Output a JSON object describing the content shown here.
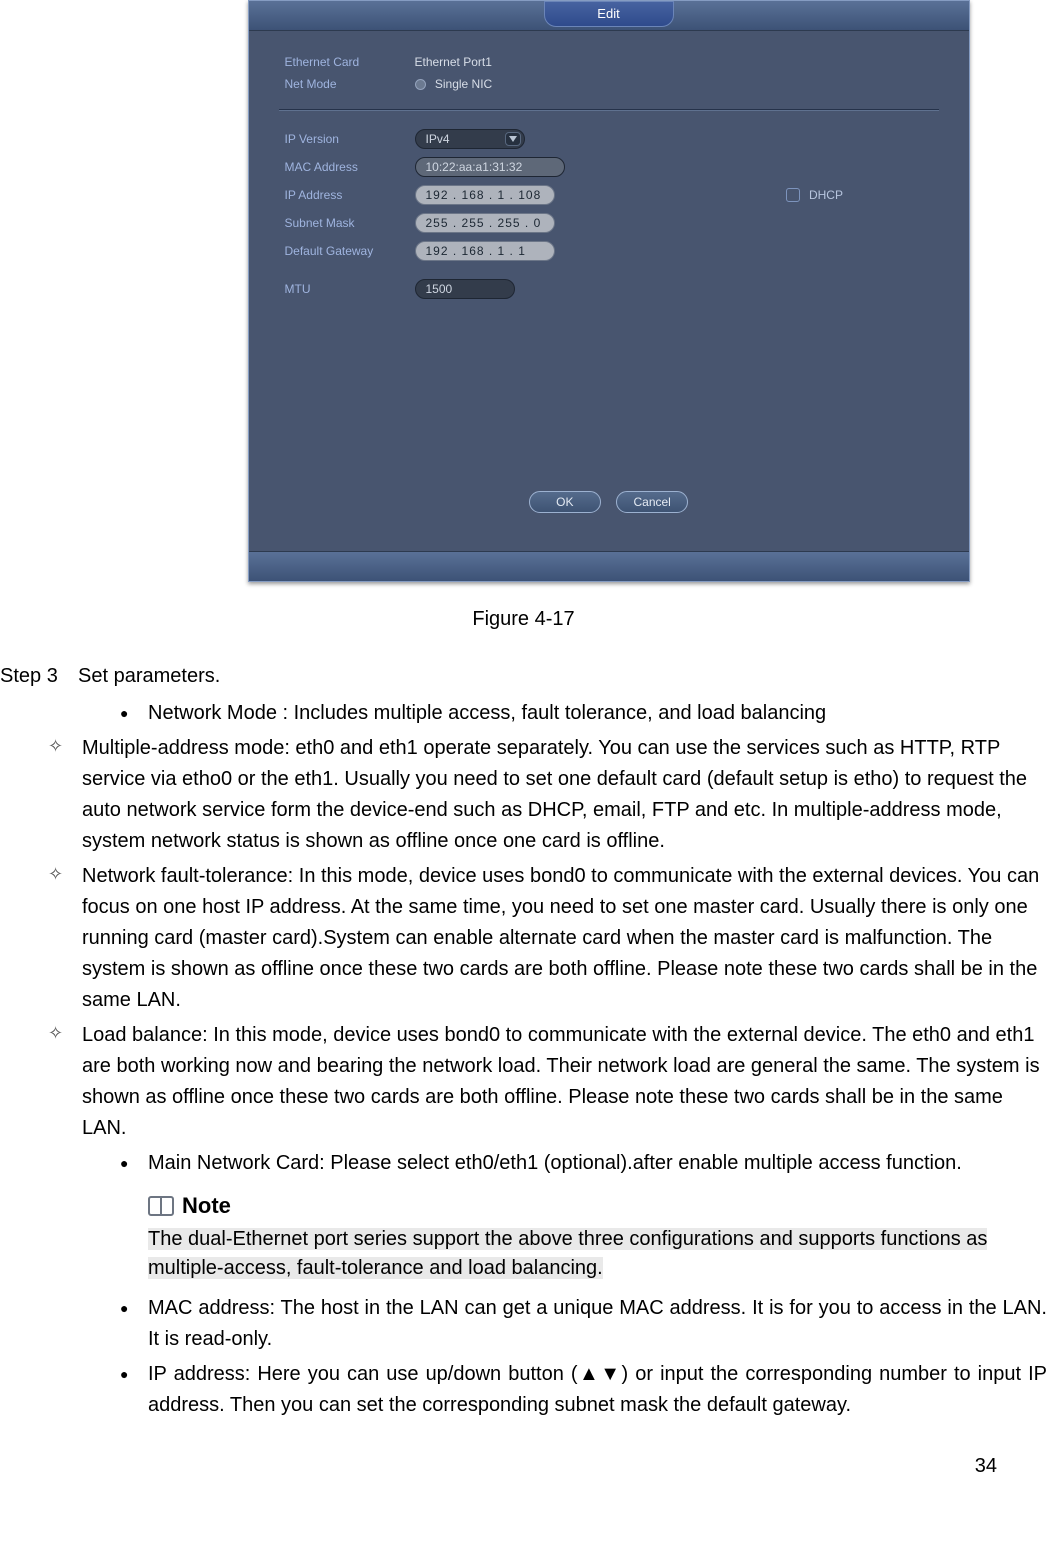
{
  "dialog": {
    "title": "Edit",
    "ethernet_card_label": "Ethernet Card",
    "ethernet_card_value": "Ethernet Port1",
    "net_mode_label": "Net Mode",
    "net_mode_value": "Single NIC",
    "ip_version_label": "IP Version",
    "ip_version_value": "IPv4",
    "mac_label": "MAC Address",
    "mac_value": "10:22:aa:a1:31:32",
    "ip_label": "IP Address",
    "ip_value": "192 . 168 .   1   . 108",
    "dhcp_label": "DHCP",
    "subnet_label": "Subnet Mask",
    "subnet_value": "255 . 255 . 255 .   0",
    "gateway_label": "Default Gateway",
    "gateway_value": "192 . 168 .   1   .   1",
    "mtu_label": "MTU",
    "mtu_value": "1500",
    "ok_label": "OK",
    "cancel_label": "Cancel"
  },
  "caption": "Figure 4-17",
  "step3_label": "Step 3",
  "step3_text": "Set parameters.",
  "b1": "Network Mode : Includes multiple access, fault tolerance, and load balancing",
  "d1": "Multiple-address mode: eth0 and eth1 operate separately. You can use the services such as HTTP, RTP service via etho0 or the eth1. Usually you need to set one default card (default setup is etho) to request the auto network service form the device-end such as DHCP, email, FTP and etc. In multiple-address mode, system network status is shown as offline once one card is offline.",
  "d2": "Network fault-tolerance: In this mode, device uses bond0 to communicate with the external devices. You can focus on one host IP address. At the same time, you need to set one master card. Usually there is only one running card (master card).System can enable alternate card when the master card is malfunction. The system is shown as offline once these two cards are both offline. Please note these two cards shall be in the same LAN.",
  "d3": "Load balance: In this mode, device uses bond0 to communicate with the external device. The eth0 and eth1 are both working now and bearing the network load. Their network load are general the same. The system is shown as offline once these two cards are both offline. Please note these two cards shall be in the same LAN.",
  "b2": "Main Network Card: Please select eth0/eth1 (optional).after enable multiple access function.",
  "note_title": "Note",
  "note_text": "The dual-Ethernet port series support the above three configurations and supports functions as multiple-access, fault-tolerance and load balancing.",
  "b3": "MAC address: The host in the LAN can get a unique MAC address. It is for you to access in the LAN. It is read-only.",
  "b4": "IP address: Here you can use up/down button (▲▼) or input the corresponding number to input IP address. Then you can set the corresponding subnet mask the default gateway.",
  "page_number": "34"
}
